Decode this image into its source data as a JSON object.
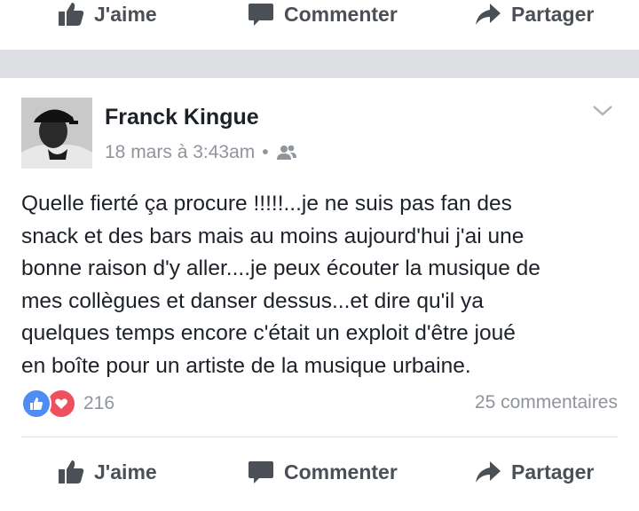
{
  "top_actions": {
    "like": "J'aime",
    "comment": "Commenter",
    "share": "Partager"
  },
  "post": {
    "author": "Franck Kingue",
    "timestamp": "18 mars à 3:43am",
    "separator": "•",
    "audience_icon": "friends-icon",
    "text_lines": [
      "Quelle fierté ça procure !!!!!...je ne suis pas fan des",
      "snack et des bars mais au moins aujourd'hui j'ai une",
      "bonne raison d'y aller....je peux écouter la musique de",
      "mes  collègues et danser dessus...et dire qu'il ya",
      "quelques temps encore  c'était un exploit d'être joué",
      "en boîte pour un artiste de la musique urbaine."
    ],
    "reaction_count": "216",
    "comment_count": "25 commentaires"
  },
  "bottom_actions": {
    "like": "J'aime",
    "comment": "Commenter",
    "share": "Partager"
  },
  "colors": {
    "reaction_like": "#4f8df5",
    "reaction_love": "#f0505e",
    "muted": "#90949c",
    "action": "#4b4f56"
  }
}
